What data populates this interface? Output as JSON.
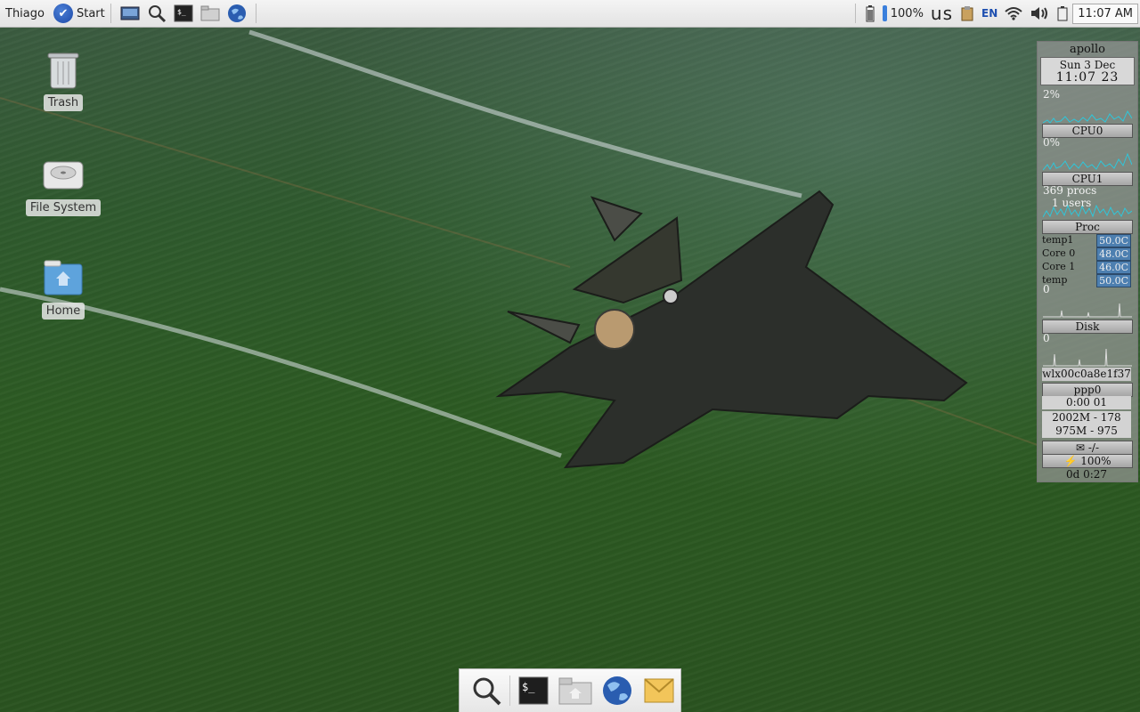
{
  "panel": {
    "user": "Thiago",
    "start_label": "Start",
    "launchers": [
      "desktop-icon",
      "search-icon",
      "terminal-icon",
      "file-manager-icon",
      "web-browser-icon"
    ],
    "tray": {
      "battery_percent": "100%",
      "keyboard_layout": "us",
      "input_method": "EN",
      "time": "11:07 AM"
    }
  },
  "desktop_icons": [
    {
      "label": "Trash",
      "icon": "trash-icon"
    },
    {
      "label": "File System",
      "icon": "drive-icon"
    },
    {
      "label": "Home",
      "icon": "home-folder-icon"
    }
  ],
  "conky": {
    "hostname": "apollo",
    "date": "Sun  3  Dec",
    "time": "11:07 23",
    "cpu0_pct": "2%",
    "cpu0_label": "CPU0",
    "cpu1_pct": "0%",
    "cpu1_label": "CPU1",
    "procs": "369  procs",
    "users": "1  users",
    "proc_label": "Proc",
    "temps": [
      {
        "name": "temp1",
        "value": "50.0C"
      },
      {
        "name": "Core 0",
        "value": "48.0C"
      },
      {
        "name": "Core 1",
        "value": "46.0C"
      },
      {
        "name": "temp",
        "value": "50.0C"
      }
    ],
    "disk_value": "0",
    "disk_label": "Disk",
    "net_value": "0",
    "net_iface": "wlx00c0a8e1f37",
    "ppp_label": "ppp0",
    "ppp_time": "0:00  01",
    "mem_line": "2002M - 178",
    "swap_line": "975M - 975",
    "mail": "-/-",
    "battery": "100%",
    "uptime": "0d  0:27"
  },
  "dock": {
    "items": [
      "search-icon",
      "terminal-icon",
      "file-manager-icon",
      "web-browser-icon",
      "mail-icon"
    ]
  }
}
